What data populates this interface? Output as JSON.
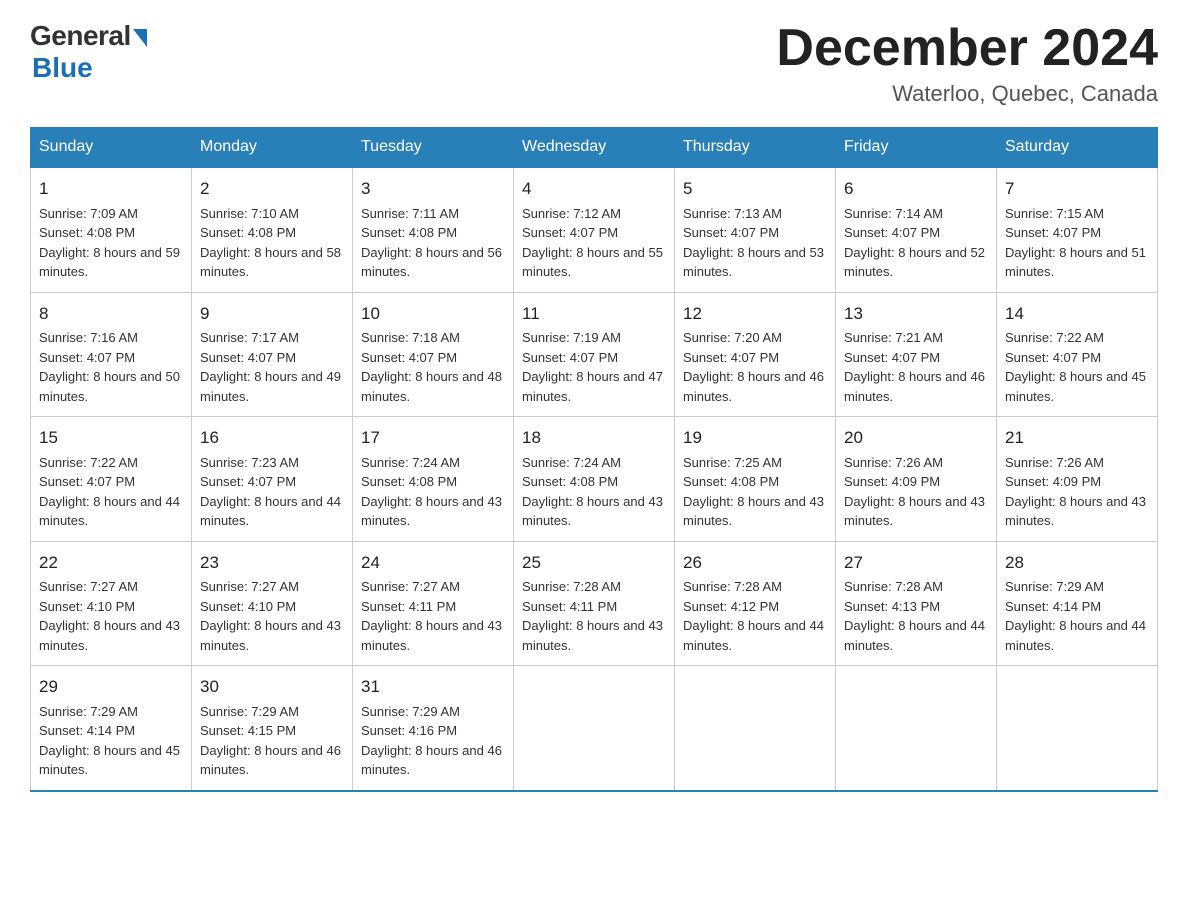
{
  "header": {
    "logo_general": "General",
    "logo_blue": "Blue",
    "title": "December 2024",
    "subtitle": "Waterloo, Quebec, Canada"
  },
  "weekdays": [
    "Sunday",
    "Monday",
    "Tuesday",
    "Wednesday",
    "Thursday",
    "Friday",
    "Saturday"
  ],
  "weeks": [
    [
      {
        "day": "1",
        "sunrise": "7:09 AM",
        "sunset": "4:08 PM",
        "daylight": "8 hours and 59 minutes."
      },
      {
        "day": "2",
        "sunrise": "7:10 AM",
        "sunset": "4:08 PM",
        "daylight": "8 hours and 58 minutes."
      },
      {
        "day": "3",
        "sunrise": "7:11 AM",
        "sunset": "4:08 PM",
        "daylight": "8 hours and 56 minutes."
      },
      {
        "day": "4",
        "sunrise": "7:12 AM",
        "sunset": "4:07 PM",
        "daylight": "8 hours and 55 minutes."
      },
      {
        "day": "5",
        "sunrise": "7:13 AM",
        "sunset": "4:07 PM",
        "daylight": "8 hours and 53 minutes."
      },
      {
        "day": "6",
        "sunrise": "7:14 AM",
        "sunset": "4:07 PM",
        "daylight": "8 hours and 52 minutes."
      },
      {
        "day": "7",
        "sunrise": "7:15 AM",
        "sunset": "4:07 PM",
        "daylight": "8 hours and 51 minutes."
      }
    ],
    [
      {
        "day": "8",
        "sunrise": "7:16 AM",
        "sunset": "4:07 PM",
        "daylight": "8 hours and 50 minutes."
      },
      {
        "day": "9",
        "sunrise": "7:17 AM",
        "sunset": "4:07 PM",
        "daylight": "8 hours and 49 minutes."
      },
      {
        "day": "10",
        "sunrise": "7:18 AM",
        "sunset": "4:07 PM",
        "daylight": "8 hours and 48 minutes."
      },
      {
        "day": "11",
        "sunrise": "7:19 AM",
        "sunset": "4:07 PM",
        "daylight": "8 hours and 47 minutes."
      },
      {
        "day": "12",
        "sunrise": "7:20 AM",
        "sunset": "4:07 PM",
        "daylight": "8 hours and 46 minutes."
      },
      {
        "day": "13",
        "sunrise": "7:21 AM",
        "sunset": "4:07 PM",
        "daylight": "8 hours and 46 minutes."
      },
      {
        "day": "14",
        "sunrise": "7:22 AM",
        "sunset": "4:07 PM",
        "daylight": "8 hours and 45 minutes."
      }
    ],
    [
      {
        "day": "15",
        "sunrise": "7:22 AM",
        "sunset": "4:07 PM",
        "daylight": "8 hours and 44 minutes."
      },
      {
        "day": "16",
        "sunrise": "7:23 AM",
        "sunset": "4:07 PM",
        "daylight": "8 hours and 44 minutes."
      },
      {
        "day": "17",
        "sunrise": "7:24 AM",
        "sunset": "4:08 PM",
        "daylight": "8 hours and 43 minutes."
      },
      {
        "day": "18",
        "sunrise": "7:24 AM",
        "sunset": "4:08 PM",
        "daylight": "8 hours and 43 minutes."
      },
      {
        "day": "19",
        "sunrise": "7:25 AM",
        "sunset": "4:08 PM",
        "daylight": "8 hours and 43 minutes."
      },
      {
        "day": "20",
        "sunrise": "7:26 AM",
        "sunset": "4:09 PM",
        "daylight": "8 hours and 43 minutes."
      },
      {
        "day": "21",
        "sunrise": "7:26 AM",
        "sunset": "4:09 PM",
        "daylight": "8 hours and 43 minutes."
      }
    ],
    [
      {
        "day": "22",
        "sunrise": "7:27 AM",
        "sunset": "4:10 PM",
        "daylight": "8 hours and 43 minutes."
      },
      {
        "day": "23",
        "sunrise": "7:27 AM",
        "sunset": "4:10 PM",
        "daylight": "8 hours and 43 minutes."
      },
      {
        "day": "24",
        "sunrise": "7:27 AM",
        "sunset": "4:11 PM",
        "daylight": "8 hours and 43 minutes."
      },
      {
        "day": "25",
        "sunrise": "7:28 AM",
        "sunset": "4:11 PM",
        "daylight": "8 hours and 43 minutes."
      },
      {
        "day": "26",
        "sunrise": "7:28 AM",
        "sunset": "4:12 PM",
        "daylight": "8 hours and 44 minutes."
      },
      {
        "day": "27",
        "sunrise": "7:28 AM",
        "sunset": "4:13 PM",
        "daylight": "8 hours and 44 minutes."
      },
      {
        "day": "28",
        "sunrise": "7:29 AM",
        "sunset": "4:14 PM",
        "daylight": "8 hours and 44 minutes."
      }
    ],
    [
      {
        "day": "29",
        "sunrise": "7:29 AM",
        "sunset": "4:14 PM",
        "daylight": "8 hours and 45 minutes."
      },
      {
        "day": "30",
        "sunrise": "7:29 AM",
        "sunset": "4:15 PM",
        "daylight": "8 hours and 46 minutes."
      },
      {
        "day": "31",
        "sunrise": "7:29 AM",
        "sunset": "4:16 PM",
        "daylight": "8 hours and 46 minutes."
      },
      null,
      null,
      null,
      null
    ]
  ]
}
